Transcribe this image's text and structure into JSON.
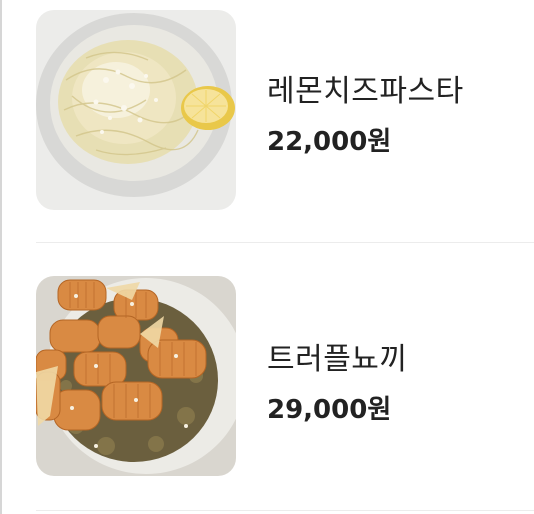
{
  "menu": {
    "items": [
      {
        "name": "레몬치즈파스타",
        "price": "22,000원",
        "image_icon": "lemon-cheese-pasta-photo"
      },
      {
        "name": "트러플뇨끼",
        "price": "29,000원",
        "image_icon": "truffle-gnocchi-photo"
      }
    ]
  },
  "colors": {
    "text": "#222222",
    "divider": "#ececec",
    "left_border": "#d6d6d6",
    "background": "#ffffff"
  }
}
